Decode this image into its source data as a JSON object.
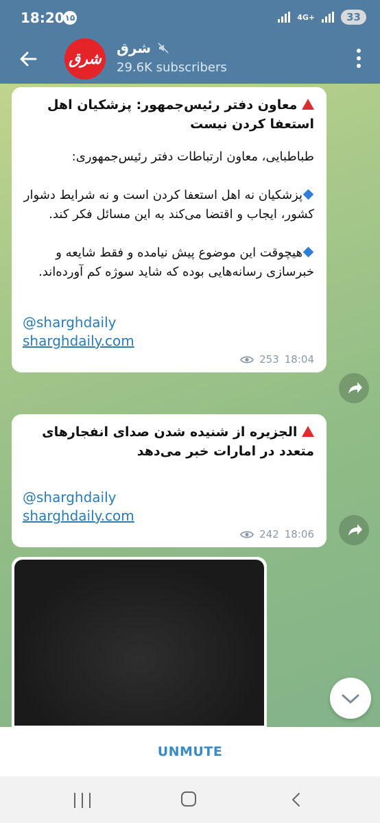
{
  "status_bar": {
    "time": "18:20",
    "notification_badge": "۱۵",
    "network": "4G+",
    "battery": "33"
  },
  "header": {
    "channel_name": "شرق",
    "subscribers": "29.6K subscribers",
    "avatar_text": "شرق"
  },
  "messages": [
    {
      "title": "معاون دفتر رئیس‌جمهور: پزشکیان اهل استعفا کردن نیست",
      "intro": "طباطبایی، معاون ارتباطات دفتر رئیس‌جمهوری:",
      "point1": "پزشکیان نه اهل استعفا کردن است و نه شرایط دشوار کشور، ایجاب و اقتضا می‌کند به این مسائل فکر کند.",
      "point2": "هیچوقت این موضوع پیش نیامده و فقط شایعه و خبرسازی رسانه‌هایی بوده که شاید سوژه کم آورده‌اند.",
      "handle": "@sharghdaily",
      "site": "sharghdaily.com",
      "views": "253",
      "time": "18:04"
    },
    {
      "title": "الجزیره از شنیده شدن صدای انفجارهای متعدد در امارات خبر می‌دهد",
      "handle": "@sharghdaily",
      "site": "sharghdaily.com",
      "views": "242",
      "time": "18:06"
    }
  ],
  "bottom": {
    "unmute_label": "UNMUTE"
  },
  "colors": {
    "header_bg": "#517da2",
    "link": "#2a7cb6",
    "unmute": "#3a8ac4",
    "alert_triangle": "#d9302f",
    "bullet_diamond": "#2f7fd8"
  }
}
